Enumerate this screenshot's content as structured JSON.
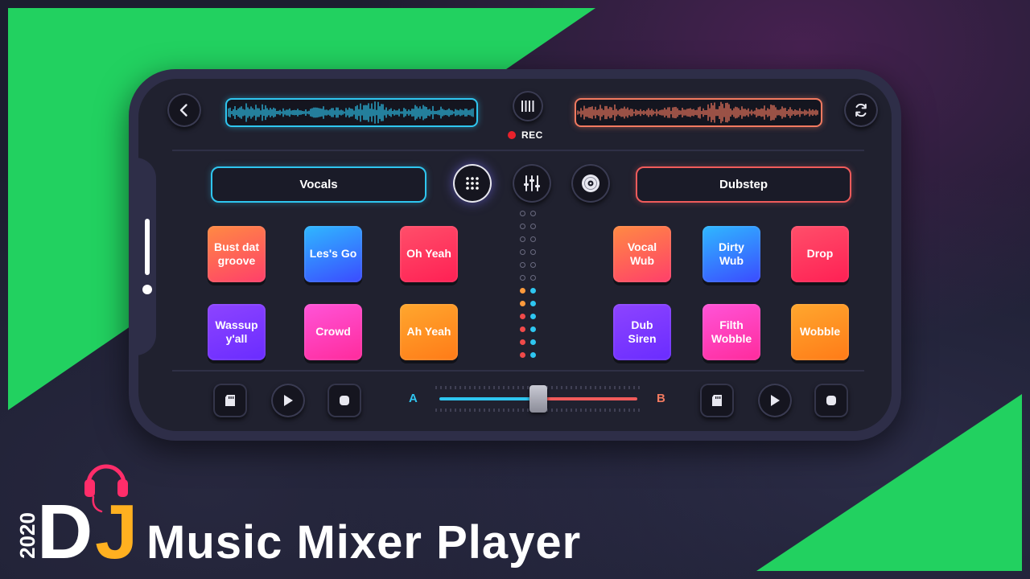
{
  "deck_a": {
    "track": "Vocals",
    "label": "A"
  },
  "deck_b": {
    "track": "Dubstep",
    "label": "B"
  },
  "record": {
    "label": "REC"
  },
  "pads_a": [
    {
      "label": "Bust dat groove",
      "color": "orange-red"
    },
    {
      "label": "Les's Go",
      "color": "blue"
    },
    {
      "label": "Oh Yeah",
      "color": "red"
    },
    {
      "label": "Wassup y'all",
      "color": "purple"
    },
    {
      "label": "Crowd",
      "color": "pink"
    },
    {
      "label": "Ah Yeah",
      "color": "orange"
    }
  ],
  "pads_b": [
    {
      "label": "Vocal Wub",
      "color": "orange-red"
    },
    {
      "label": "Dirty Wub",
      "color": "blue"
    },
    {
      "label": "Drop",
      "color": "red"
    },
    {
      "label": "Dub Siren",
      "color": "purple"
    },
    {
      "label": "Filth Wobble",
      "color": "pink"
    },
    {
      "label": "Wobble",
      "color": "orange"
    }
  ],
  "crossfader": {
    "position": 0.5
  },
  "branding": {
    "year": "2020",
    "logo_d": "D",
    "logo_j": "J",
    "title": "Music Mixer Player"
  },
  "icons": {
    "back": "chevron-left-icon",
    "sync": "sync-icon",
    "equalizer": "equalizer-bars-icon",
    "pads": "pad-grid-icon",
    "mixer": "mixer-sliders-icon",
    "disc": "disc-icon",
    "sampler": "sd-card-icon",
    "play": "play-icon",
    "stop": "stop-icon",
    "headphones": "headphones-icon"
  },
  "colors": {
    "accent_green": "#22d160",
    "deck_a": "#2fc6f0",
    "deck_b": "#f27a60",
    "logo_j": "#ffb020",
    "headphones": "#ff2d6a"
  }
}
